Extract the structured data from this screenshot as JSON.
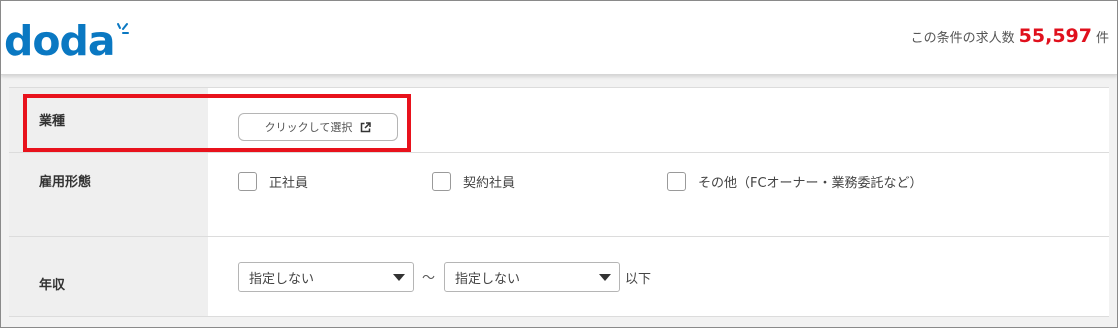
{
  "header": {
    "logo_text": "doda",
    "count_label": "この条件の求人数",
    "count_value": "55,597",
    "count_unit": "件"
  },
  "form": {
    "industry": {
      "label": "業種",
      "button_label": "クリックして選択"
    },
    "employment": {
      "label": "雇用形態",
      "options": [
        "正社員",
        "契約社員",
        "その他（FCオーナー・業務委託など）"
      ]
    },
    "income": {
      "label": "年収",
      "min_value": "指定しない",
      "separator": "〜",
      "max_value": "指定しない",
      "suffix": "以下"
    }
  },
  "colors": {
    "brand": "#0a78c2",
    "count": "#e0101d",
    "highlight": "#e8121c"
  },
  "icons": {
    "external": "external-link-icon",
    "dropdown": "chevron-down-icon",
    "scroll": "scroll-up-icon"
  }
}
